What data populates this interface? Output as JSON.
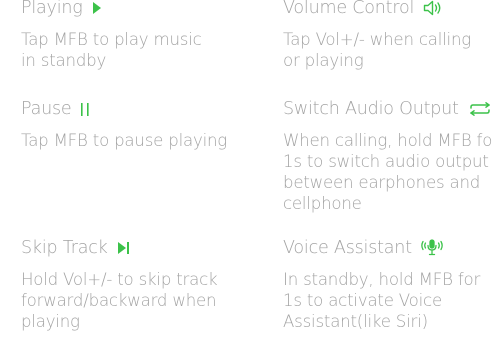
{
  "accent_color": "#3cc24a",
  "text_color": "#a3a3a3",
  "items": {
    "playing": {
      "title": "Playing",
      "icon": "play-icon",
      "lines": [
        "Tap MFB to play music",
        "in standby"
      ]
    },
    "volume": {
      "title": "Volume Control",
      "icon": "speaker-icon",
      "lines": [
        "Tap Vol+/- when calling",
        "or playing"
      ]
    },
    "pause": {
      "title": "Pause",
      "icon": "pause-icon",
      "lines": [
        "Tap MFB to pause playing"
      ]
    },
    "switch_audio": {
      "title": "Switch Audio Output",
      "icon": "switch-arrows-icon",
      "lines": [
        "When calling, hold MFB for",
        "1s to switch audio output",
        "between earphones and",
        "cellphone"
      ]
    },
    "skip": {
      "title": "Skip Track",
      "icon": "skip-track-icon",
      "lines": [
        "Hold Vol+/- to skip track",
        "forward/backward when",
        "playing"
      ]
    },
    "voice": {
      "title": "Voice Assistant",
      "icon": "microphone-icon",
      "lines": [
        "In standby, hold MFB for",
        "1s to activate Voice",
        "Assistant(like Siri)"
      ]
    }
  }
}
